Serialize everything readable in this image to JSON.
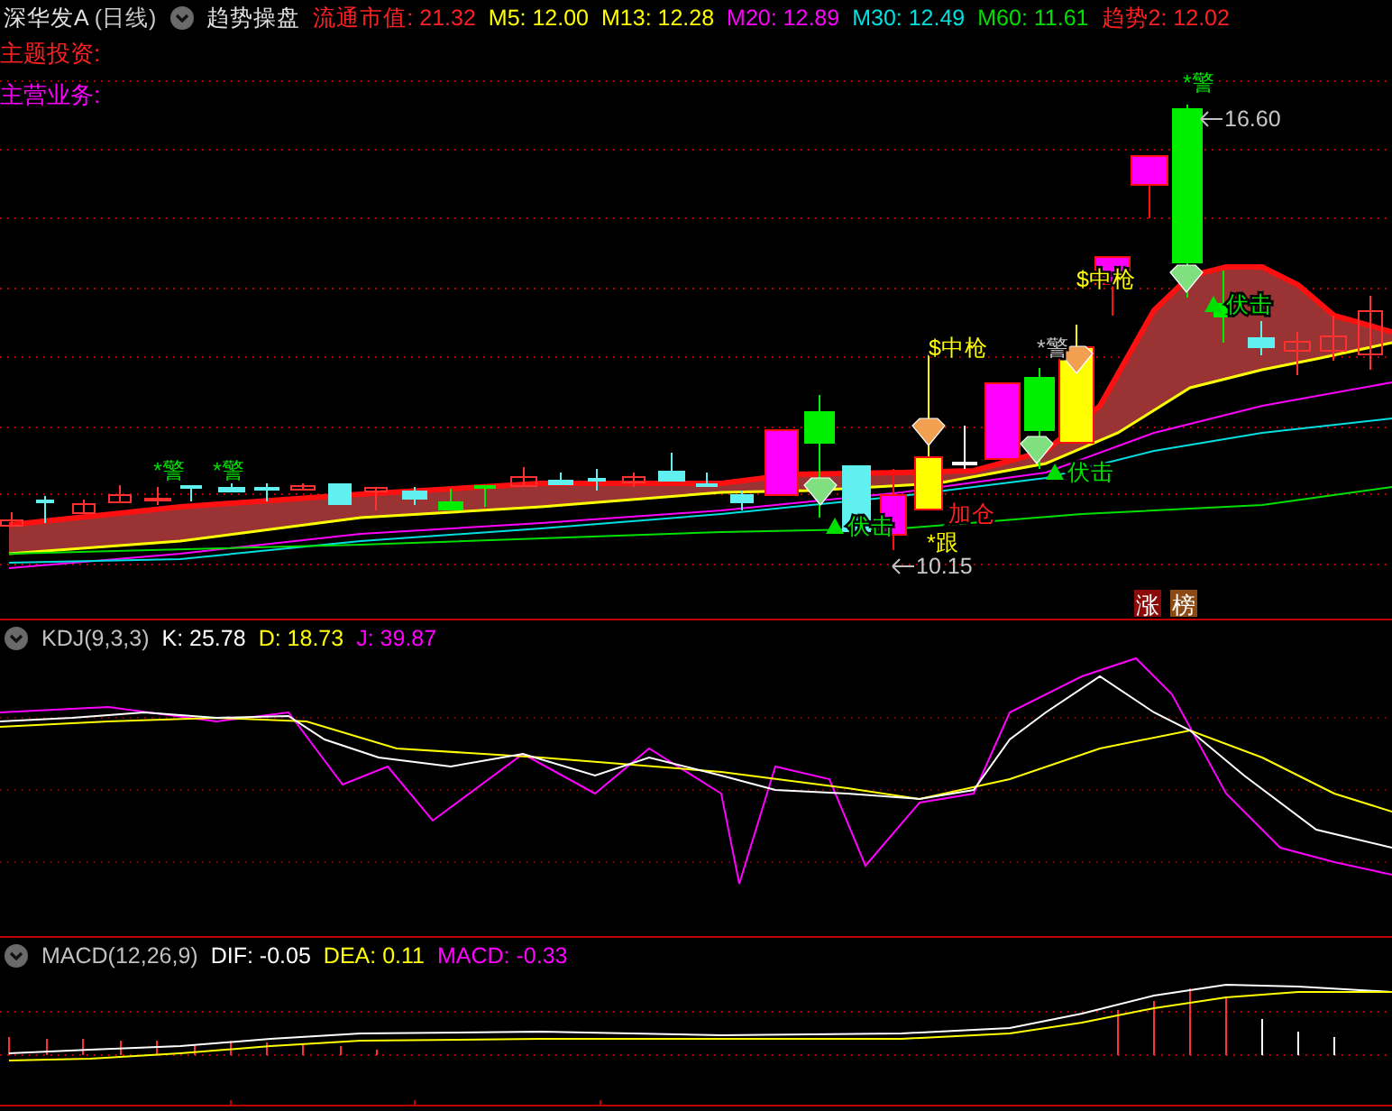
{
  "header": {
    "title": "深华发A",
    "period": "(日线)",
    "indicator": "趋势操盘",
    "legend": [
      {
        "text": "流通市值: 21.32",
        "color": "#ff2020"
      },
      {
        "text": "M5: 12.00",
        "color": "#ffff00"
      },
      {
        "text": "M13: 12.28",
        "color": "#ffff00"
      },
      {
        "text": "M20: 12.89",
        "color": "#ff00ff"
      },
      {
        "text": "M30: 12.49",
        "color": "#00e0e0"
      },
      {
        "text": "M60: 11.61",
        "color": "#00e000"
      },
      {
        "text": "趋势2: 12.02",
        "color": "#ff2020"
      }
    ]
  },
  "info_lines": [
    {
      "text": "主题投资:",
      "color": "#ff2020"
    },
    {
      "text": "主营业务:",
      "color": "#ff00ff"
    }
  ],
  "main_chart": {
    "signals": [
      {
        "kind": "mark",
        "text": "*警",
        "color": "#00e000"
      },
      {
        "kind": "mark",
        "text": "*警",
        "color": "#00e000"
      },
      {
        "kind": "mark",
        "text": "*警",
        "color": "#00e000"
      },
      {
        "kind": "mark",
        "text": "*警",
        "color": "#c0c0c0"
      },
      {
        "kind": "mark",
        "text": "$中枪",
        "color": "#ffff00"
      },
      {
        "kind": "mark",
        "text": "$中枪",
        "color": "#ffff00"
      },
      {
        "kind": "ambush",
        "text": "伏击",
        "color": "#00e000"
      },
      {
        "kind": "ambush",
        "text": "伏击",
        "color": "#00e000"
      },
      {
        "kind": "ambush",
        "text": "伏击",
        "color": "#00e000"
      },
      {
        "kind": "mark",
        "text": "加仓",
        "color": "#ff2020"
      },
      {
        "kind": "mark",
        "text": "*跟",
        "color": "#ffff00"
      }
    ],
    "price_marks": [
      {
        "text": "16.60"
      },
      {
        "text": "10.15"
      }
    ],
    "badges": [
      {
        "text": "涨",
        "color": "#8b0a0a"
      },
      {
        "text": "榜",
        "color": "#8b4a14"
      }
    ]
  },
  "kdj": {
    "title": "KDJ(9,3,3)",
    "legend": [
      {
        "text": "K: 25.78",
        "color": "#ffffff"
      },
      {
        "text": "D: 18.73",
        "color": "#ffff00"
      },
      {
        "text": "J: 39.87",
        "color": "#ff00ff"
      }
    ]
  },
  "macd": {
    "title": "MACD(12,26,9)",
    "legend": [
      {
        "text": "DIF: -0.05",
        "color": "#ffffff"
      },
      {
        "text": "DEA: 0.11",
        "color": "#ffff00"
      },
      {
        "text": "MACD: -0.33",
        "color": "#ff00ff"
      }
    ]
  }
}
